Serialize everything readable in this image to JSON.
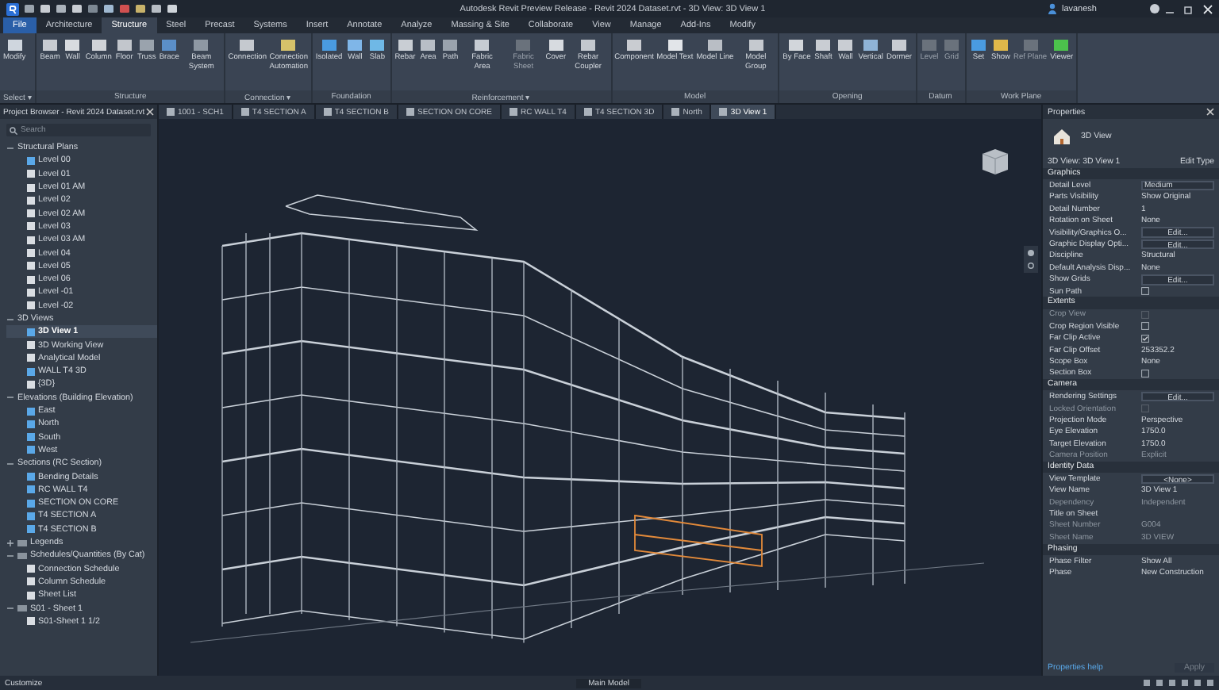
{
  "title_bar": {
    "title": "Autodesk Revit Preview Release - Revit 2024 Dataset.rvt - 3D View: 3D View 1",
    "user": "lavanesh"
  },
  "ribbon_tabs": [
    {
      "label": "File",
      "selected": false,
      "kind": "file"
    },
    {
      "label": "Architecture",
      "selected": false
    },
    {
      "label": "Structure",
      "selected": true
    },
    {
      "label": "Steel",
      "selected": false
    },
    {
      "label": "Precast",
      "selected": false
    },
    {
      "label": "Systems",
      "selected": false
    },
    {
      "label": "Insert",
      "selected": false
    },
    {
      "label": "Annotate",
      "selected": false
    },
    {
      "label": "Analyze",
      "selected": false
    },
    {
      "label": "Massing & Site",
      "selected": false
    },
    {
      "label": "Collaborate",
      "selected": false
    },
    {
      "label": "View",
      "selected": false
    },
    {
      "label": "Manage",
      "selected": false
    },
    {
      "label": "Add-Ins",
      "selected": false
    },
    {
      "label": "Modify",
      "selected": false
    }
  ],
  "ribbon_panels": [
    {
      "label": "Select ▾",
      "tools": [
        {
          "label": "Modify",
          "disabled": false,
          "color": "#cfd6de"
        }
      ]
    },
    {
      "label": "Structure",
      "tools": [
        {
          "label": "Beam",
          "disabled": false,
          "color": "#c8ccd2"
        },
        {
          "label": "Wall",
          "disabled": false,
          "color": "#d8dbe0"
        },
        {
          "label": "Column",
          "disabled": false,
          "color": "#d0d3d8"
        },
        {
          "label": "Floor",
          "disabled": false,
          "color": "#c2c6cc"
        },
        {
          "label": "Truss",
          "disabled": false,
          "color": "#9aa3ad"
        },
        {
          "label": "Brace",
          "disabled": false,
          "color": "#5b8fc8"
        },
        {
          "label": "Beam System",
          "disabled": false,
          "color": "#8e98a3"
        }
      ]
    },
    {
      "label": "Connection ▾",
      "tools": [
        {
          "label": "Connection",
          "disabled": false,
          "color": "#c5c9cf"
        },
        {
          "label": "Connection Automation",
          "disabled": false,
          "color": "#d6c26a"
        }
      ]
    },
    {
      "label": "Foundation",
      "tools": [
        {
          "label": "Isolated",
          "disabled": false,
          "color": "#4a9be0"
        },
        {
          "label": "Wall",
          "disabled": false,
          "color": "#7fb6e8"
        },
        {
          "label": "Slab",
          "disabled": false,
          "color": "#6fb8e6"
        }
      ]
    },
    {
      "label": "Reinforcement ▾",
      "tools": [
        {
          "label": "Rebar",
          "disabled": false,
          "color": "#c9ced4"
        },
        {
          "label": "Area",
          "disabled": false,
          "color": "#b8bec6"
        },
        {
          "label": "Path",
          "disabled": false,
          "color": "#9aa3ad"
        },
        {
          "label": "Fabric Area",
          "disabled": false,
          "color": "#c6ccd3"
        },
        {
          "label": "Fabric Sheet",
          "disabled": true,
          "color": "#6a727c"
        },
        {
          "label": "Cover",
          "disabled": false,
          "color": "#d7dbe0"
        },
        {
          "label": "Rebar Coupler",
          "disabled": false,
          "color": "#c3c8ce"
        }
      ]
    },
    {
      "label": "Model",
      "tools": [
        {
          "label": "Component",
          "disabled": false,
          "color": "#c9ccd1"
        },
        {
          "label": "Model Text",
          "disabled": false,
          "color": "#e2e5e9"
        },
        {
          "label": "Model Line",
          "disabled": false,
          "color": "#b9bec5"
        },
        {
          "label": "Model Group",
          "disabled": false,
          "color": "#c5c9cf"
        }
      ]
    },
    {
      "label": "Opening",
      "tools": [
        {
          "label": "By Face",
          "disabled": false,
          "color": "#d2d6db"
        },
        {
          "label": "Shaft",
          "disabled": false,
          "color": "#c9cdd3"
        },
        {
          "label": "Wall",
          "disabled": false,
          "color": "#c9cdd3"
        },
        {
          "label": "Vertical",
          "disabled": false,
          "color": "#8fb3d6"
        },
        {
          "label": "Dormer",
          "disabled": false,
          "color": "#c8ccd2"
        }
      ]
    },
    {
      "label": "Datum",
      "tools": [
        {
          "label": "Level",
          "disabled": true,
          "color": "#6a727c"
        },
        {
          "label": "Grid",
          "disabled": true,
          "color": "#6a727c"
        }
      ]
    },
    {
      "label": "Work Plane",
      "tools": [
        {
          "label": "Set",
          "disabled": false,
          "color": "#4a9be0"
        },
        {
          "label": "Show",
          "disabled": false,
          "color": "#e0b84a"
        },
        {
          "label": "Ref Plane",
          "disabled": true,
          "color": "#6a727c"
        },
        {
          "label": "Viewer",
          "disabled": false,
          "color": "#4cc24c"
        }
      ]
    }
  ],
  "project_browser": {
    "title": "Project Browser - Revit 2024 Dataset.rvt",
    "search": {
      "placeholder": "Search"
    },
    "tree": [
      {
        "label": "Structural Plans",
        "expanded": true,
        "children": [
          {
            "label": "Level 00",
            "open": true,
            "selected": false
          },
          {
            "label": "Level 01",
            "open": false,
            "selected": false
          },
          {
            "label": "Level 01 AM",
            "open": false,
            "selected": false
          },
          {
            "label": "Level 02",
            "open": false,
            "selected": false
          },
          {
            "label": "Level 02 AM",
            "open": false,
            "selected": false
          },
          {
            "label": "Level 03",
            "open": false,
            "selected": false
          },
          {
            "label": "Level 03 AM",
            "open": false,
            "selected": false
          },
          {
            "label": "Level 04",
            "open": false,
            "selected": false
          },
          {
            "label": "Level 05",
            "open": false,
            "selected": false
          },
          {
            "label": "Level 06",
            "open": false,
            "selected": false
          },
          {
            "label": "Level -01",
            "open": false,
            "selected": false
          },
          {
            "label": "Level -02",
            "open": false,
            "selected": false
          }
        ]
      },
      {
        "label": "3D Views",
        "expanded": true,
        "children": [
          {
            "label": "3D View 1",
            "open": true,
            "selected": true
          },
          {
            "label": "3D Working View",
            "open": false,
            "selected": false
          },
          {
            "label": "Analytical Model",
            "open": false,
            "selected": false
          },
          {
            "label": "WALL T4 3D",
            "open": true,
            "selected": false
          },
          {
            "label": "{3D}",
            "open": false,
            "selected": false
          }
        ]
      },
      {
        "label": "Elevations (Building Elevation)",
        "expanded": true,
        "children": [
          {
            "label": "East",
            "open": true,
            "selected": false
          },
          {
            "label": "North",
            "open": true,
            "selected": false
          },
          {
            "label": "South",
            "open": true,
            "selected": false
          },
          {
            "label": "West",
            "open": true,
            "selected": false
          }
        ]
      },
      {
        "label": "Sections (RC Section)",
        "expanded": true,
        "children": [
          {
            "label": "Bending Details",
            "open": true,
            "selected": false
          },
          {
            "label": "RC WALL T4",
            "open": true,
            "selected": false
          },
          {
            "label": "SECTION ON CORE",
            "open": true,
            "selected": false
          },
          {
            "label": "T4 SECTION A",
            "open": true,
            "selected": false
          },
          {
            "label": "T4 SECTION B",
            "open": true,
            "selected": false
          }
        ]
      },
      {
        "label": "Legends",
        "expanded": false
      },
      {
        "label": "Schedules/Quantities (By Cat)",
        "expanded": true,
        "children": [
          {
            "label": "Connection Schedule",
            "open": false,
            "selected": false
          },
          {
            "label": "Column Schedule",
            "open": false,
            "selected": false
          },
          {
            "label": "Sheet List",
            "open": false,
            "selected": false
          }
        ]
      },
      {
        "label": "S01 - Sheet 1",
        "expanded": true,
        "children": [
          {
            "label": "S01-Sheet 1 1/2",
            "open": false,
            "selected": false
          }
        ]
      }
    ]
  },
  "view_tabs": [
    {
      "label": "1001 - SCH1",
      "selected": false
    },
    {
      "label": "T4 SECTION A",
      "selected": false
    },
    {
      "label": "T4 SECTION B",
      "selected": false
    },
    {
      "label": "SECTION ON CORE",
      "selected": false
    },
    {
      "label": "RC WALL T4",
      "selected": false
    },
    {
      "label": "T4 SECTION 3D",
      "selected": false
    },
    {
      "label": "North",
      "selected": false
    },
    {
      "label": "3D View 1",
      "selected": true
    }
  ],
  "properties": {
    "title": "Properties",
    "type_name": "3D View",
    "instance": "3D View: 3D View 1",
    "edit_type": "Edit Type",
    "groups": [
      {
        "label": "Graphics",
        "rows": [
          {
            "name": "Detail Level",
            "value": "Medium",
            "kind": "field",
            "disabled": false
          },
          {
            "name": "Parts Visibility",
            "value": "Show Original",
            "kind": "text",
            "disabled": false
          },
          {
            "name": "Detail Number",
            "value": "1",
            "kind": "text",
            "disabled": false
          },
          {
            "name": "Rotation on Sheet",
            "value": "None",
            "kind": "text",
            "disabled": false
          },
          {
            "name": "Visibility/Graphics O...",
            "value": "Edit...",
            "kind": "button",
            "disabled": false
          },
          {
            "name": "Graphic Display Opti...",
            "value": "Edit...",
            "kind": "button",
            "disabled": false
          },
          {
            "name": "Discipline",
            "value": "Structural",
            "kind": "text",
            "disabled": false
          },
          {
            "name": "Default Analysis Disp...",
            "value": "None",
            "kind": "text",
            "disabled": false
          },
          {
            "name": "Show Grids",
            "value": "Edit...",
            "kind": "button",
            "disabled": false
          },
          {
            "name": "Sun Path",
            "checked": false,
            "kind": "check",
            "disabled": false
          }
        ]
      },
      {
        "label": "Extents",
        "rows": [
          {
            "name": "Crop View",
            "checked": false,
            "kind": "check",
            "disabled": true
          },
          {
            "name": "Crop Region Visible",
            "checked": false,
            "kind": "check",
            "disabled": false
          },
          {
            "name": "Far Clip Active",
            "checked": true,
            "kind": "check",
            "disabled": false
          },
          {
            "name": "Far Clip Offset",
            "value": "253352.2",
            "kind": "text",
            "disabled": false
          },
          {
            "name": "Scope Box",
            "value": "None",
            "kind": "text",
            "disabled": false
          },
          {
            "name": "Section Box",
            "checked": false,
            "kind": "check",
            "disabled": false
          }
        ]
      },
      {
        "label": "Camera",
        "rows": [
          {
            "name": "Rendering Settings",
            "value": "Edit...",
            "kind": "button",
            "disabled": false
          },
          {
            "name": "Locked Orientation",
            "checked": false,
            "kind": "check",
            "disabled": true
          },
          {
            "name": "Projection Mode",
            "value": "Perspective",
            "kind": "text",
            "disabled": false
          },
          {
            "name": "Eye Elevation",
            "value": "1750.0",
            "kind": "text",
            "disabled": false
          },
          {
            "name": "Target Elevation",
            "value": "1750.0",
            "kind": "text",
            "disabled": false
          },
          {
            "name": "Camera Position",
            "value": "Explicit",
            "kind": "text",
            "disabled": true
          }
        ]
      },
      {
        "label": "Identity Data",
        "rows": [
          {
            "name": "View Template",
            "value": "<None>",
            "kind": "button",
            "disabled": false
          },
          {
            "name": "View Name",
            "value": "3D View 1",
            "kind": "text",
            "disabled": false
          },
          {
            "name": "Dependency",
            "value": "Independent",
            "kind": "text",
            "disabled": true
          },
          {
            "name": "Title on Sheet",
            "kind": "text",
            "disabled": false
          },
          {
            "name": "Sheet Number",
            "value": "G004",
            "kind": "text",
            "disabled": true
          },
          {
            "name": "Sheet Name",
            "value": "3D VIEW",
            "kind": "text",
            "disabled": true
          }
        ]
      },
      {
        "label": "Phasing",
        "rows": [
          {
            "name": "Phase Filter",
            "value": "Show All",
            "kind": "text",
            "disabled": false
          },
          {
            "name": "Phase",
            "value": "New Construction",
            "kind": "text",
            "disabled": false
          }
        ]
      }
    ],
    "help_link": "Properties help",
    "apply": "Apply"
  },
  "status_bar": {
    "left": "Customize",
    "model": "Main Model"
  }
}
